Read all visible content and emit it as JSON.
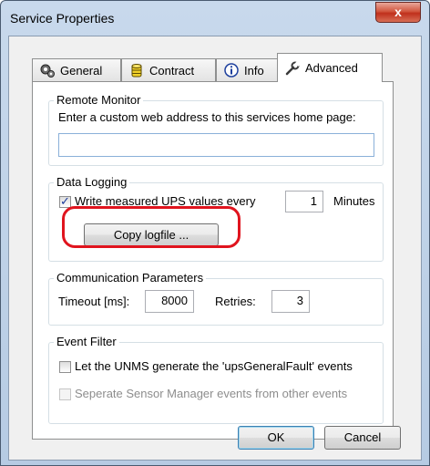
{
  "window": {
    "title": "Service Properties",
    "close_glyph": "x"
  },
  "tabs": [
    {
      "label": "General",
      "icon": "gears-icon",
      "active": false
    },
    {
      "label": "Contract",
      "icon": "database-icon",
      "active": false
    },
    {
      "label": "Info",
      "icon": "info-icon",
      "active": false
    },
    {
      "label": "Advanced",
      "icon": "wrench-icon",
      "active": true
    }
  ],
  "remote_monitor": {
    "legend": "Remote Monitor",
    "description": "Enter a custom web address to this services home page:",
    "url_value": ""
  },
  "data_logging": {
    "legend": "Data Logging",
    "checkbox_label": "Write measured UPS values every",
    "checked": true,
    "interval_value": "1",
    "unit_label": "Minutes",
    "copy_button_label": "Copy logfile ..."
  },
  "communication": {
    "legend": "Communication Parameters",
    "timeout_label": "Timeout [ms]:",
    "timeout_value": "8000",
    "retries_label": "Retries:",
    "retries_value": "3"
  },
  "event_filter": {
    "legend": "Event Filter",
    "option1_label": "Let the UNMS generate the 'upsGeneralFault' events",
    "option1_checked": false,
    "option2_label": "Seperate Sensor Manager events from other events",
    "option2_checked": false,
    "option2_disabled": true
  },
  "buttons": {
    "ok_label": "OK",
    "cancel_label": "Cancel"
  },
  "colors": {
    "highlight": "#e0141e",
    "close_button": "#c0301c"
  }
}
